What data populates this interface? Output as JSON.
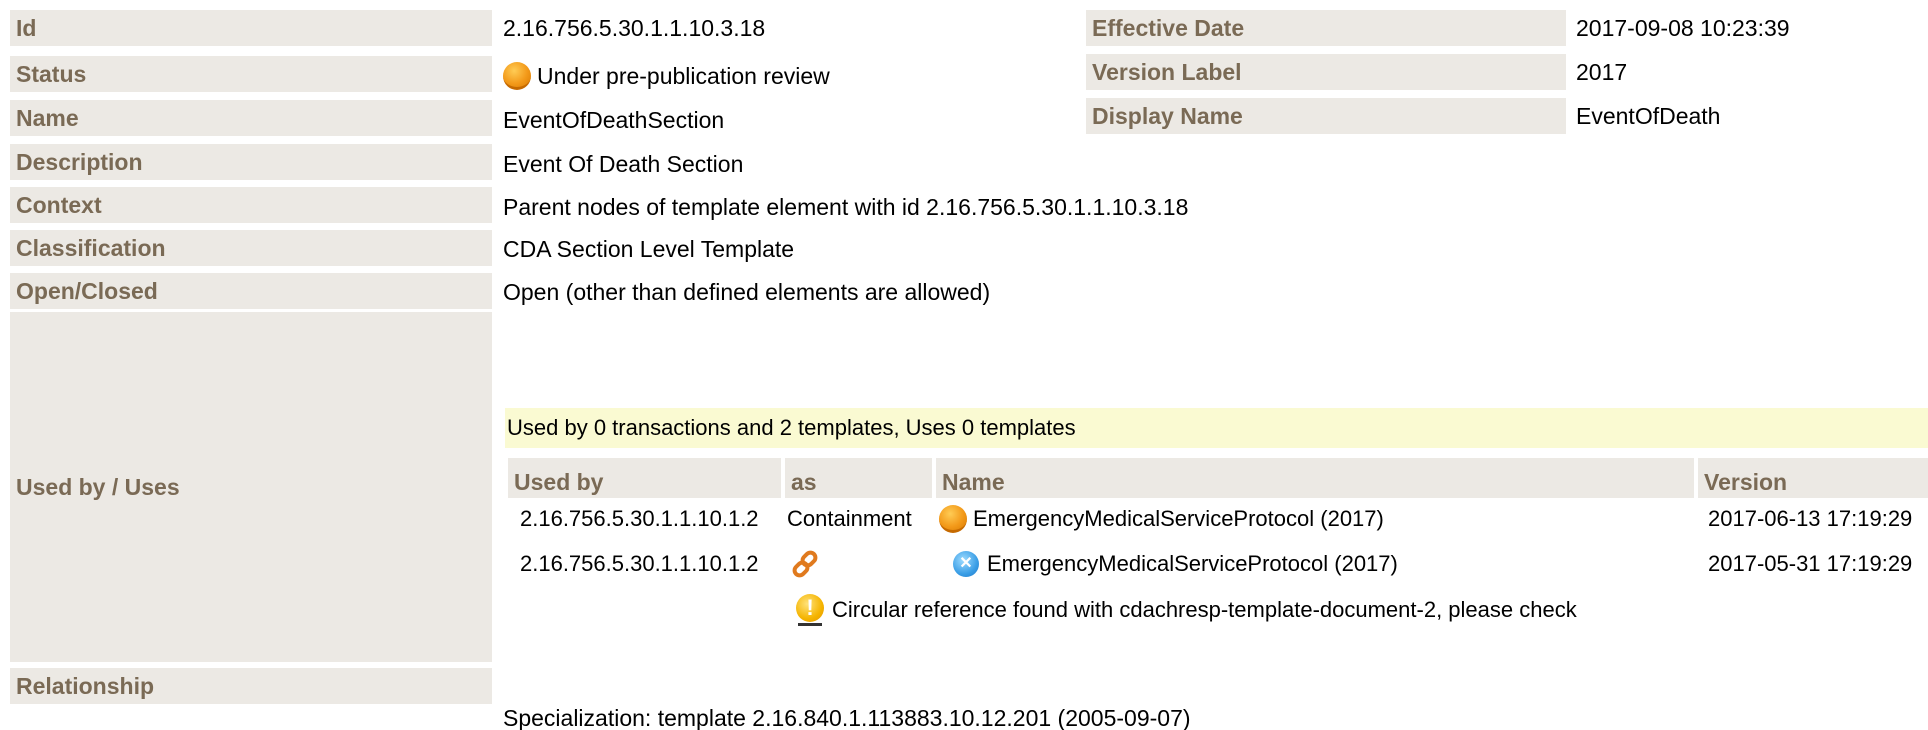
{
  "left": [
    {
      "label": "Id",
      "value": "2.16.756.5.30.1.1.10.3.18"
    },
    {
      "label": "Status",
      "value": "Under pre-publication review"
    },
    {
      "label": "Name",
      "value": "EventOfDeathSection"
    },
    {
      "label": "Description",
      "value": "Event Of Death Section"
    },
    {
      "label": "Context",
      "value": "Parent nodes of template element with id 2.16.756.5.30.1.1.10.3.18"
    },
    {
      "label": "Classification",
      "value": "CDA Section Level Template"
    },
    {
      "label": "Open/Closed",
      "value": "Open (other than defined elements are allowed)"
    }
  ],
  "right": [
    {
      "label": "Effective Date",
      "value": "2017-09-08 10:23:39"
    },
    {
      "label": "Version Label",
      "value": "2017"
    },
    {
      "label": "Display Name",
      "value": "EventOfDeath"
    }
  ],
  "usage": {
    "label": "Used by / Uses",
    "summary": "Used by 0 transactions and 2 templates, Uses 0 templates",
    "headers": {
      "used_by": "Used by",
      "as": "as",
      "name": "Name",
      "version": "Version"
    },
    "rows": [
      {
        "used_by": "2.16.756.5.30.1.1.10.1.2",
        "as": "Containment",
        "as_icon": "",
        "name": "EmergencyMedicalServiceProtocol (2017)",
        "status_icon": "pending-status-icon",
        "version": "2017-06-13 17:19:29"
      },
      {
        "used_by": "2.16.756.5.30.1.1.10.1.2",
        "as": "",
        "as_icon": "link-icon",
        "name": "EmergencyMedicalServiceProtocol (2017)",
        "status_icon": "cancelled-status-icon",
        "version": "2017-05-31 17:19:29"
      }
    ],
    "warning": "Circular reference found with cdachresp-template-document-2, please check"
  },
  "relationship": {
    "label": "Relationship",
    "value": "Specialization: template 2.16.840.1.113883.10.12.201 (2005-09-07)"
  },
  "colors": {
    "label_bg": "#ece9e4",
    "label_text": "#7a6a55",
    "banner_bg": "#fafad2"
  }
}
